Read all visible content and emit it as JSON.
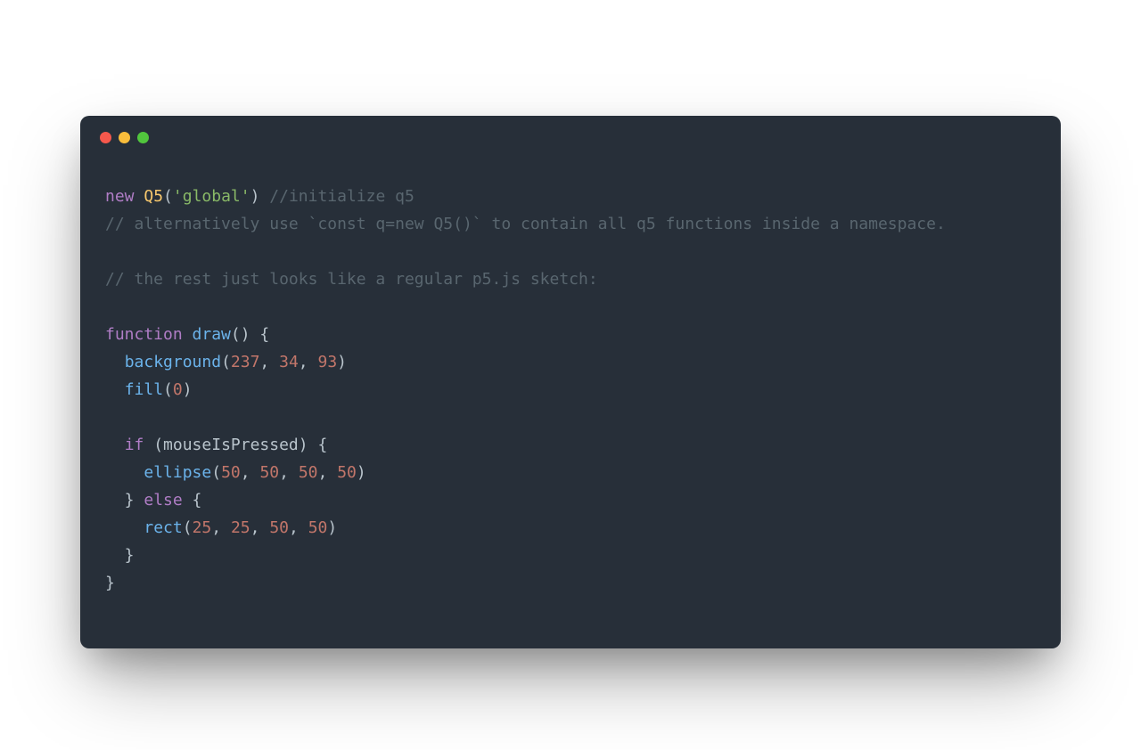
{
  "colors": {
    "window_bg": "#272f39",
    "traffic_red": "#f6584c",
    "traffic_yellow": "#f9bd3b",
    "traffic_green": "#51c63d",
    "keyword": "#b07dc6",
    "class": "#f6c76d",
    "string": "#89b967",
    "function_call": "#6bb3eb",
    "number": "#c2766a",
    "comment": "#59666f",
    "default": "#b9c4cc"
  },
  "code": {
    "lines": [
      [
        {
          "c": "kw",
          "t": "new"
        },
        {
          "c": "pn",
          "t": " "
        },
        {
          "c": "cls",
          "t": "Q5"
        },
        {
          "c": "pn",
          "t": "("
        },
        {
          "c": "str",
          "t": "'global'"
        },
        {
          "c": "pn",
          "t": ") "
        },
        {
          "c": "cm",
          "t": "//initialize q5"
        }
      ],
      [
        {
          "c": "cm",
          "t": "// alternatively use `const q=new Q5()` to contain all q5 functions inside a namespace."
        }
      ],
      [],
      [
        {
          "c": "cm",
          "t": "// the rest just looks like a regular p5.js sketch:"
        }
      ],
      [],
      [
        {
          "c": "kw",
          "t": "function"
        },
        {
          "c": "pn",
          "t": " "
        },
        {
          "c": "fn",
          "t": "draw"
        },
        {
          "c": "pn",
          "t": "() {"
        }
      ],
      [
        {
          "c": "pn",
          "t": "  "
        },
        {
          "c": "fn",
          "t": "background"
        },
        {
          "c": "pn",
          "t": "("
        },
        {
          "c": "num",
          "t": "237"
        },
        {
          "c": "pn",
          "t": ", "
        },
        {
          "c": "num",
          "t": "34"
        },
        {
          "c": "pn",
          "t": ", "
        },
        {
          "c": "num",
          "t": "93"
        },
        {
          "c": "pn",
          "t": ")"
        }
      ],
      [
        {
          "c": "pn",
          "t": "  "
        },
        {
          "c": "fn",
          "t": "fill"
        },
        {
          "c": "pn",
          "t": "("
        },
        {
          "c": "num",
          "t": "0"
        },
        {
          "c": "pn",
          "t": ")"
        }
      ],
      [],
      [
        {
          "c": "pn",
          "t": "  "
        },
        {
          "c": "kw",
          "t": "if"
        },
        {
          "c": "pn",
          "t": " (mouseIsPressed) {"
        }
      ],
      [
        {
          "c": "pn",
          "t": "    "
        },
        {
          "c": "fn",
          "t": "ellipse"
        },
        {
          "c": "pn",
          "t": "("
        },
        {
          "c": "num",
          "t": "50"
        },
        {
          "c": "pn",
          "t": ", "
        },
        {
          "c": "num",
          "t": "50"
        },
        {
          "c": "pn",
          "t": ", "
        },
        {
          "c": "num",
          "t": "50"
        },
        {
          "c": "pn",
          "t": ", "
        },
        {
          "c": "num",
          "t": "50"
        },
        {
          "c": "pn",
          "t": ")"
        }
      ],
      [
        {
          "c": "pn",
          "t": "  } "
        },
        {
          "c": "kw",
          "t": "else"
        },
        {
          "c": "pn",
          "t": " {"
        }
      ],
      [
        {
          "c": "pn",
          "t": "    "
        },
        {
          "c": "fn",
          "t": "rect"
        },
        {
          "c": "pn",
          "t": "("
        },
        {
          "c": "num",
          "t": "25"
        },
        {
          "c": "pn",
          "t": ", "
        },
        {
          "c": "num",
          "t": "25"
        },
        {
          "c": "pn",
          "t": ", "
        },
        {
          "c": "num",
          "t": "50"
        },
        {
          "c": "pn",
          "t": ", "
        },
        {
          "c": "num",
          "t": "50"
        },
        {
          "c": "pn",
          "t": ")"
        }
      ],
      [
        {
          "c": "pn",
          "t": "  }"
        }
      ],
      [
        {
          "c": "pn",
          "t": "}"
        }
      ]
    ]
  }
}
